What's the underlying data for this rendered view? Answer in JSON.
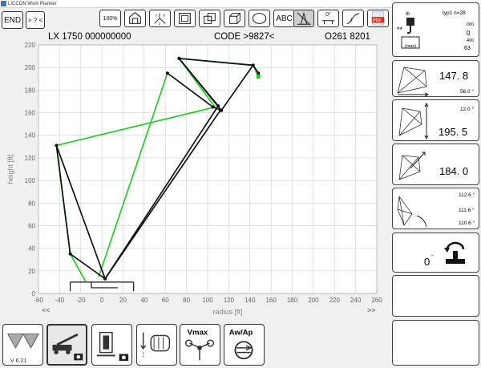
{
  "window": {
    "title": "LICCON Work Planner"
  },
  "toolbar": {
    "end_label": "END",
    "help_label": "> ? <",
    "zoom_label": "100%",
    "abc_label": "ABC",
    "angle_label": "0°",
    "pdf_label": "PDF"
  },
  "header": {
    "model": "LX 1750",
    "serial": "000000000",
    "code": "CODE >9827<",
    "ref": "O261 8201"
  },
  "chart_data": {
    "type": "line",
    "xlabel": "radius [ft]",
    "ylabel": "height [ft]",
    "xlim": [
      -60,
      260
    ],
    "ylim": [
      0,
      220
    ],
    "xticks": [
      -60,
      -40,
      -20,
      0,
      20,
      40,
      60,
      80,
      100,
      120,
      140,
      160,
      180,
      200,
      220,
      240,
      260
    ],
    "yticks": [
      0,
      20,
      40,
      60,
      80,
      100,
      120,
      140,
      160,
      180,
      200,
      220
    ],
    "grid": true,
    "left_nav": "<<",
    "right_nav": ">>",
    "series": [
      {
        "color": "#22cc22",
        "x": [
          -15,
          -30,
          -43,
          107,
          73,
          143,
          148
        ],
        "y": [
          10,
          35,
          131,
          165,
          208,
          202,
          192
        ]
      },
      {
        "color": "#22cc22",
        "x": [
          -3,
          62
        ],
        "y": [
          15,
          195
        ]
      },
      {
        "color": "#111111",
        "x": [
          3,
          -30,
          -43,
          3,
          110,
          73,
          143,
          148
        ],
        "y": [
          13,
          35,
          131,
          13,
          166,
          208,
          202,
          195
        ]
      },
      {
        "color": "#111111",
        "x": [
          3,
          112
        ],
        "y": [
          13,
          162
        ]
      },
      {
        "color": "#111111",
        "x": [
          62,
          105,
          113,
          143
        ],
        "y": [
          195,
          165,
          162,
          202
        ]
      },
      {
        "color": "#111111",
        "x": [
          73,
          113
        ],
        "y": [
          208,
          162
        ]
      }
    ]
  },
  "right_panel": {
    "load": {
      "unit": "lb",
      "typ": "typ1  n=28",
      "val1": "000",
      "val2": "0",
      "val3": "400",
      "val4": "63",
      "mode": "(max)"
    },
    "radius": {
      "value": "147. 8",
      "angle": "56.0 °"
    },
    "height": {
      "value": "195. 5",
      "angle": "12.0 °"
    },
    "length": {
      "value": "184. 0"
    },
    "angles": {
      "a1": "112.6 °",
      "a2": "111.6 °",
      "a3": "110.6 °"
    },
    "slew": {
      "value": "0",
      "unit": "°"
    }
  },
  "footer": {
    "version": "V 6.21",
    "vmax_label": "Vmax",
    "awap_label": "Aw/Ap"
  }
}
